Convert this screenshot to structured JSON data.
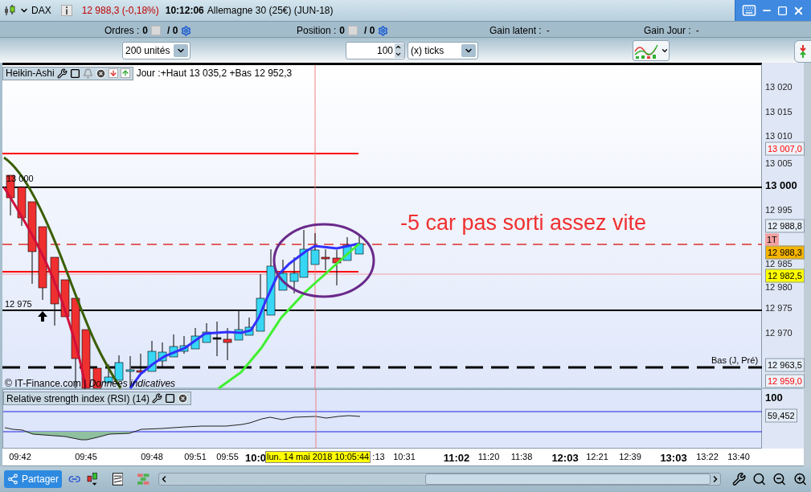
{
  "header": {
    "instrument": "DAX",
    "price_change": "12 988,3 (-0,18%)",
    "time": "10:12:06",
    "contract": "Allemagne 30 (25€) (JUN-18)"
  },
  "info_bar": [
    {
      "kind": "counter",
      "label": "Ordres :",
      "count": "0",
      "total": "/ 0"
    },
    {
      "kind": "counter",
      "label": "Position :",
      "count": "0",
      "total": "/ 0"
    },
    {
      "kind": "gain",
      "label": "Gain latent :",
      "value": "-"
    },
    {
      "kind": "gain",
      "label": "Gain Jour :",
      "value": "-"
    }
  ],
  "toolbar": {
    "period_select": "200 unités",
    "tick_count": "100",
    "unit_select": "(x) ticks"
  },
  "chart": {
    "indicator": "Heikin-Ashi",
    "day_range": "Jour :+Haut 13 035,2 +Bas 12 952,3",
    "annotation": "-5 car pas sorti assez vite",
    "copyright": "© IT-Finance.com | *Données indicatives*",
    "level_labels": [
      {
        "text": "13 000"
      },
      {
        "text": "12 975"
      },
      {
        "text": "Bas (J, Pré)"
      }
    ],
    "price_axis": [
      {
        "kind": "tick",
        "text": "13 020"
      },
      {
        "kind": "tick",
        "text": "13 015"
      },
      {
        "kind": "tick",
        "text": "13 010"
      },
      {
        "kind": "alert",
        "text": "13 007,0"
      },
      {
        "kind": "tick",
        "text": "13 005"
      },
      {
        "kind": "major",
        "text": "13 000"
      },
      {
        "kind": "tick",
        "text": "12 995"
      },
      {
        "kind": "badge",
        "text": "12 988,8",
        "color": "#e4ecf6"
      },
      {
        "kind": "marker",
        "text": "1T",
        "color": "#f4a0a0"
      },
      {
        "kind": "badge",
        "text": "12 988,3",
        "color": "#f5b400"
      },
      {
        "kind": "tick",
        "text": "12 985"
      },
      {
        "kind": "badge",
        "text": "12 982,5",
        "color": "#ffff00"
      },
      {
        "kind": "tick",
        "text": "12 980"
      },
      {
        "kind": "tick",
        "text": "12 975"
      },
      {
        "kind": "tick",
        "text": "12 970"
      },
      {
        "kind": "badge",
        "text": "12 963,5",
        "color": "#e4ecf6"
      },
      {
        "kind": "alert",
        "text": "12 959,0"
      }
    ]
  },
  "rsi": {
    "title": "Relative strength index (RSI) (14)",
    "axis": [
      {
        "kind": "major",
        "text": "100"
      },
      {
        "kind": "badge",
        "text": "59,452",
        "color": "#e4ecf6"
      }
    ]
  },
  "time_axis": [
    {
      "text": "09:42",
      "bold": false
    },
    {
      "text": "09:45",
      "bold": false
    },
    {
      "text": "09:48",
      "bold": false
    },
    {
      "text": "09:51",
      "bold": false
    },
    {
      "text": "09:55",
      "bold": false
    },
    {
      "text": "10:0",
      "bold": true
    },
    {
      "text": ":13",
      "bold": false
    },
    {
      "text": "10:31",
      "bold": false
    },
    {
      "text": "11:02",
      "bold": true
    },
    {
      "text": "11:20",
      "bold": false
    },
    {
      "text": "11:38",
      "bold": false
    },
    {
      "text": "12:03",
      "bold": true
    },
    {
      "text": "12:21",
      "bold": false
    },
    {
      "text": "12:39",
      "bold": false
    },
    {
      "text": "13:03",
      "bold": true
    },
    {
      "text": "13:22",
      "bold": false
    },
    {
      "text": "13:40",
      "bold": false
    }
  ],
  "cursor_time": "lun. 14 mai 2018 10:05:44",
  "footer": {
    "share_button": "Partager"
  }
}
